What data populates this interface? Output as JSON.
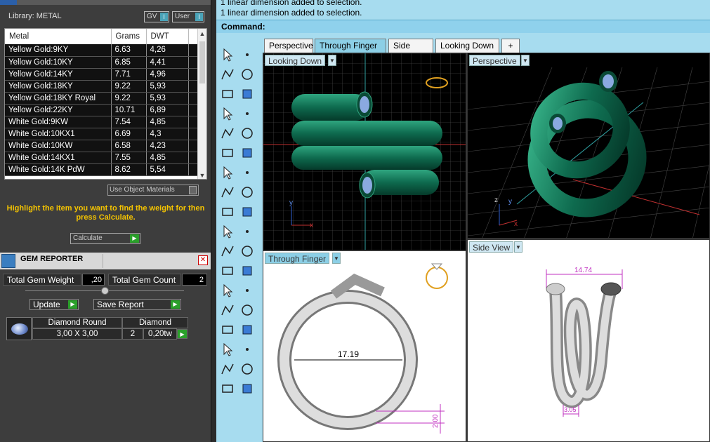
{
  "library": {
    "label": "Library: METAL",
    "gv": "GV",
    "user": "User"
  },
  "metal_table": {
    "headers": [
      "Metal",
      "Grams",
      "DWT"
    ],
    "rows": [
      [
        "Yellow Gold:9KY",
        "6.63",
        "4,26"
      ],
      [
        "Yellow Gold:10KY",
        "6.85",
        "4,41"
      ],
      [
        "Yellow Gold:14KY",
        "7.71",
        "4,96"
      ],
      [
        "Yellow Gold:18KY",
        "9.22",
        "5,93"
      ],
      [
        "Yellow Gold:18KY Royal",
        "9.22",
        "5,93"
      ],
      [
        "Yellow Gold:22KY",
        "10.71",
        "6,89"
      ],
      [
        "White Gold:9KW",
        "7.54",
        "4,85"
      ],
      [
        "White Gold:10KX1",
        "6.69",
        "4,3"
      ],
      [
        "White Gold:10KW",
        "6.58",
        "4,23"
      ],
      [
        "White Gold:14KX1",
        "7.55",
        "4,85"
      ],
      [
        "White Gold:14K PdW",
        "8.62",
        "5,54"
      ]
    ]
  },
  "use_object_materials": "Use Object Materials",
  "hint": "Highlight the item you want to find the weight for then press Calculate.",
  "calculate_label": "Calculate",
  "gem_reporter": {
    "title": "GEM REPORTER",
    "total_weight_label": "Total Gem Weight",
    "total_weight_value": ",20",
    "total_count_label": "Total Gem Count",
    "total_count_value": "2",
    "update_label": "Update",
    "save_report_label": "Save Report",
    "gem": {
      "shape": "Diamond Round",
      "material": "Diamond",
      "size": "3,00 X 3,00",
      "count": "2",
      "weight": "0,20tw"
    }
  },
  "command": {
    "history": [
      "1 linear dimension added to selection.",
      "1 linear dimension added to selection."
    ],
    "prompt": "Command:"
  },
  "viewport_tabs": [
    "Perspective",
    "Through Finger",
    "Side View",
    "Looking Down",
    "+"
  ],
  "viewports": {
    "top": "Looking Down",
    "perspective": "Perspective",
    "front": "Through Finger",
    "right": "Side View"
  },
  "dimensions": {
    "front_diameter": "17.19",
    "front_height": "2.00",
    "side_width": "14.74",
    "side_wire": "3.05"
  },
  "axis_labels": {
    "x": "x",
    "y": "y",
    "z": "z"
  },
  "colors": {
    "command_bg": "#a7dcef",
    "ring_green": "#0e6a4e",
    "hint_yellow": "#f5c400",
    "dimension_magenta": "#c030c0"
  }
}
